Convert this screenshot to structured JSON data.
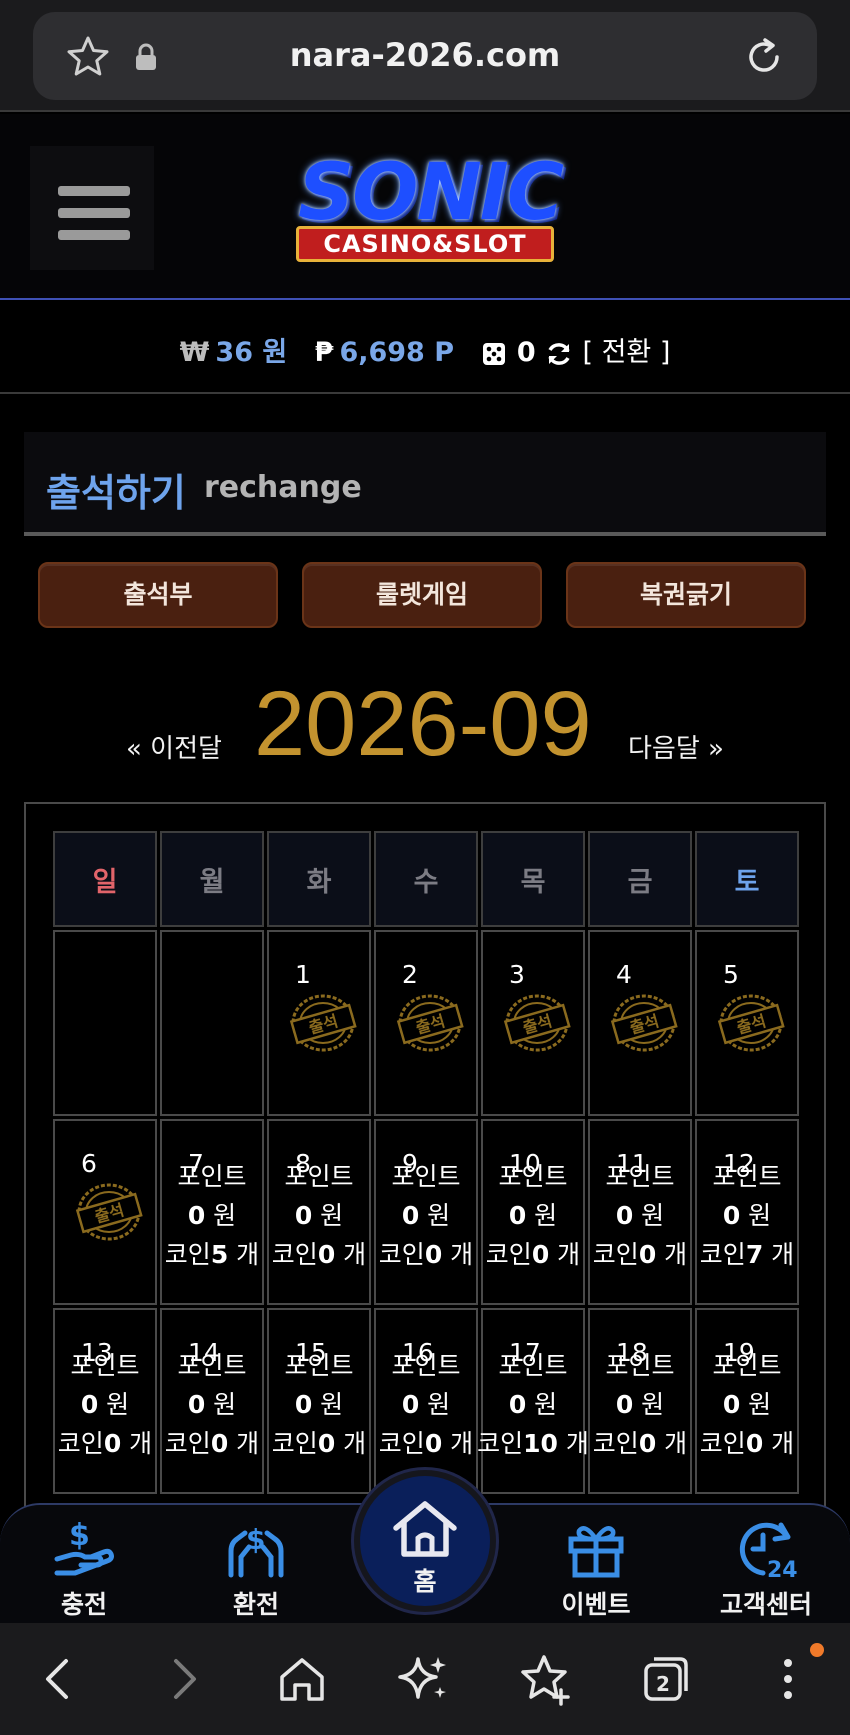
{
  "browser": {
    "url": "nara-2026.com",
    "tab_count": "2",
    "icons": [
      "star-icon",
      "lock-icon",
      "reload-icon",
      "back-icon",
      "forward-icon",
      "home-icon",
      "sparkle-icon",
      "bookmarks-icon",
      "tabs-icon",
      "more-icon"
    ]
  },
  "header": {
    "logo_title": "SONIC",
    "logo_subtitle": "CASINO&SLOT"
  },
  "balance": {
    "money_symbol": "₩",
    "money_value": "36 원",
    "point_symbol": "₱",
    "point_value": "6,698 P",
    "dice_value": "0",
    "switch_label": "[ 전환 ]"
  },
  "section": {
    "title": "출석하기",
    "subtitle": "rechange"
  },
  "tabs": [
    {
      "label": "출석부"
    },
    {
      "label": "룰렛게임"
    },
    {
      "label": "복권긁기"
    }
  ],
  "calendar": {
    "prev_label": "« 이전달",
    "month": "2026-09",
    "next_label": "다음달 »",
    "weekdays": [
      "일",
      "월",
      "화",
      "수",
      "목",
      "금",
      "토"
    ],
    "stamp_text": "출석",
    "point_label": "포인트",
    "won_unit": "원",
    "coin_label": "코인",
    "coin_unit": "개",
    "weeks": [
      [
        {
          "day": ""
        },
        {
          "day": ""
        },
        {
          "day": "1",
          "stamp": true
        },
        {
          "day": "2",
          "stamp": true
        },
        {
          "day": "3",
          "stamp": true
        },
        {
          "day": "4",
          "stamp": true
        },
        {
          "day": "5",
          "stamp": true
        }
      ],
      [
        {
          "day": "6",
          "stamp": true
        },
        {
          "day": "7",
          "points": "0",
          "coins": "5"
        },
        {
          "day": "8",
          "points": "0",
          "coins": "0"
        },
        {
          "day": "9",
          "points": "0",
          "coins": "0"
        },
        {
          "day": "10",
          "points": "0",
          "coins": "0"
        },
        {
          "day": "11",
          "points": "0",
          "coins": "0"
        },
        {
          "day": "12",
          "points": "0",
          "coins": "7"
        }
      ],
      [
        {
          "day": "13",
          "points": "0",
          "coins": "0"
        },
        {
          "day": "14",
          "points": "0",
          "coins": "0"
        },
        {
          "day": "15",
          "points": "0",
          "coins": "0"
        },
        {
          "day": "16",
          "points": "0",
          "coins": "0"
        },
        {
          "day": "17",
          "points": "0",
          "coins": "10"
        },
        {
          "day": "18",
          "points": "0",
          "coins": "0"
        },
        {
          "day": "19",
          "points": "0",
          "coins": "0"
        }
      ]
    ]
  },
  "bottom_nav": {
    "deposit": "충전",
    "withdraw": "환전",
    "home": "홈",
    "event": "이벤트",
    "support": "고객센터",
    "support_badge": "24"
  },
  "colors": {
    "accent_blue": "#6ea3ec",
    "gold": "#c3932f",
    "button_brown": "#4a2010",
    "sunday_red": "#e2646a"
  }
}
